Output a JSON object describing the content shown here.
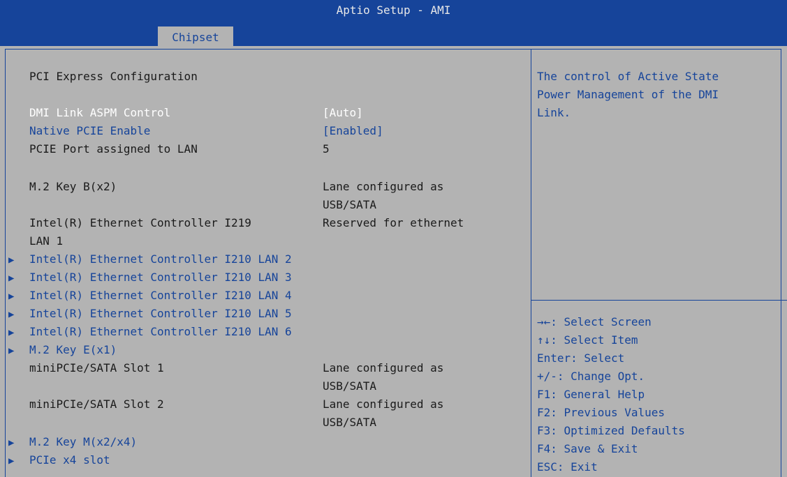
{
  "app_title": "Aptio Setup - AMI",
  "tab": "Chipset",
  "section_title": "PCI Express Configuration",
  "settings": [
    {
      "label": "DMI Link ASPM Control",
      "value": "[Auto]"
    },
    {
      "label": "Native PCIE Enable",
      "value": "[Enabled]"
    },
    {
      "label": "PCIE Port assigned to LAN",
      "value": "5"
    },
    {
      "label": "M.2 Key B(x2)",
      "value_line1": "Lane configured as",
      "value_line2": "USB/SATA"
    },
    {
      "label_line1": "Intel(R) Ethernet Controller I219",
      "label_line2": "LAN 1",
      "value": "Reserved for ethernet"
    },
    {
      "label": "miniPCIe/SATA Slot 1",
      "value_line1": "Lane configured as",
      "value_line2": "USB/SATA"
    },
    {
      "label": "miniPCIe/SATA Slot 2",
      "value_line1": "Lane configured as",
      "value_line2": "USB/SATA"
    }
  ],
  "submenus": [
    "Intel(R) Ethernet Controller I210 LAN 2",
    "Intel(R) Ethernet Controller I210 LAN 3",
    "Intel(R) Ethernet Controller I210 LAN 4",
    "Intel(R) Ethernet Controller I210 LAN 5",
    "Intel(R) Ethernet Controller I210 LAN 6",
    "M.2 Key E(x1)",
    "M.2 Key M(x2/x4)",
    "PCIe x4 slot"
  ],
  "help_text": [
    "The control of Active State",
    "Power Management of the DMI",
    "Link."
  ],
  "keys": [
    "→←: Select Screen",
    "↑↓: Select Item",
    "Enter: Select",
    "+/-: Change Opt.",
    "F1: General Help",
    "F2: Previous Values",
    "F3: Optimized Defaults",
    "F4: Save & Exit",
    "ESC: Exit"
  ],
  "submenu_arrow": "▶",
  "colors": {
    "header": "#16449a",
    "panel": "#b3b3b3",
    "highlight": "#ffffff"
  }
}
